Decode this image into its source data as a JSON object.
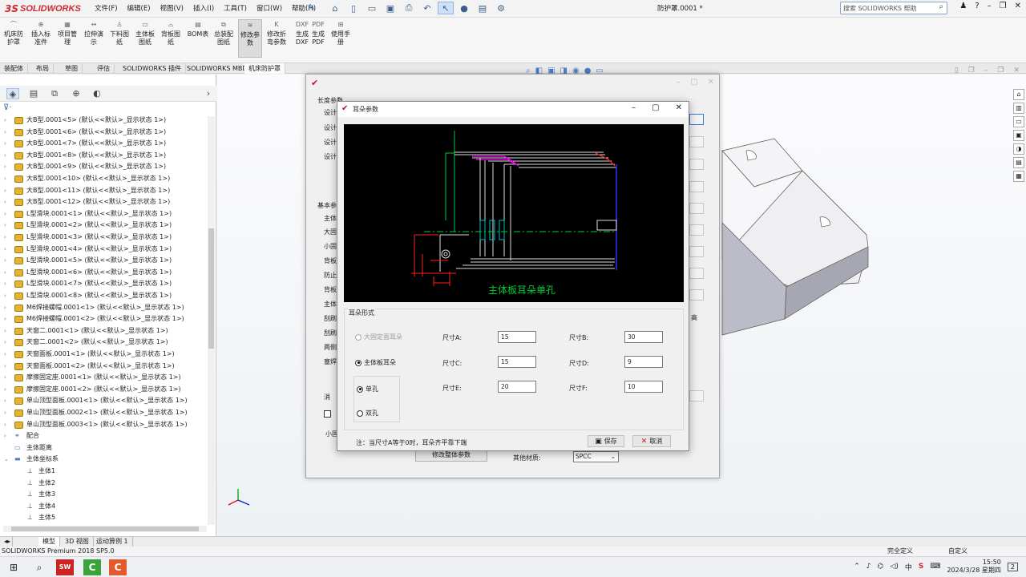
{
  "app": {
    "logo_ds": "3S",
    "logo_text": "SOLIDWORKS",
    "doc_title": "防护罩.0001 *",
    "search_placeholder": "搜索 SOLIDWORKS 帮助",
    "menus": [
      "文件(F)",
      "编辑(E)",
      "视图(V)",
      "插入(I)",
      "工具(T)",
      "窗口(W)",
      "帮助(H)"
    ]
  },
  "ribbon": {
    "buttons": [
      "机床防护罩",
      "插入标准件",
      "项目管理",
      "拉伸演示",
      "下料图纸",
      "主体板图纸",
      "背板图纸",
      "BOM表",
      "总装配图纸",
      "修改参数",
      "修改折弯参数",
      "生成DXF",
      "生成PDF",
      "使用手册"
    ]
  },
  "cmdtabs": [
    "装配体",
    "布局",
    "草图",
    "评估",
    "SOLIDWORKS 插件",
    "SOLIDWORKS MBD",
    "机床防护罩"
  ],
  "tree": {
    "items": [
      "大B型.0001<5> (默认<<默认>_显示状态 1>)",
      "大B型.0001<6> (默认<<默认>_显示状态 1>)",
      "大B型.0001<7> (默认<<默认>_显示状态 1>)",
      "大B型.0001<8> (默认<<默认>_显示状态 1>)",
      "大B型.0001<9> (默认<<默认>_显示状态 1>)",
      "大B型.0001<10> (默认<<默认>_显示状态 1>)",
      "大B型.0001<11> (默认<<默认>_显示状态 1>)",
      "大B型.0001<12> (默认<<默认>_显示状态 1>)",
      "L型滑块.0001<1> (默认<<默认>_显示状态 1>)",
      "L型滑块.0001<2> (默认<<默认>_显示状态 1>)",
      "L型滑块.0001<3> (默认<<默认>_显示状态 1>)",
      "L型滑块.0001<4> (默认<<默认>_显示状态 1>)",
      "L型滑块.0001<5> (默认<<默认>_显示状态 1>)",
      "L型滑块.0001<6> (默认<<默认>_显示状态 1>)",
      "L型滑块.0001<7> (默认<<默认>_显示状态 1>)",
      "L型滑块.0001<8> (默认<<默认>_显示状态 1>)",
      "M6焊接螺帽.0001<1> (默认<<默认>_显示状态 1>)",
      "M6焊接螺帽.0001<2> (默认<<默认>_显示状态 1>)",
      "天窗二.0001<1> (默认<<默认>_显示状态 1>)",
      "天窗二.0001<2> (默认<<默认>_显示状态 1>)",
      "天窗面板.0001<1> (默认<<默认>_显示状态 1>)",
      "天窗面板.0001<2> (默认<<默认>_显示状态 1>)",
      "摩擦固定座.0001<1> (默认<<默认>_显示状态 1>)",
      "摩擦固定座.0001<2> (默认<<默认>_显示状态 1>)",
      "单山顶型面板.0001<1> (默认<<默认>_显示状态 1>)",
      "单山顶型面板.0002<1> (默认<<默认>_显示状态 1>)",
      "单山顶型面板.0003<1> (默认<<默认>_显示状态 1>)"
    ],
    "mates": "配合",
    "origin_dist": "主体距离",
    "coord_folder": "主体坐标系",
    "coords": [
      "主体1",
      "主体2",
      "主体3",
      "主体4",
      "主体5"
    ]
  },
  "bottom_tabs": [
    "模型",
    "3D 视图",
    "运动算例 1"
  ],
  "status": {
    "version": "SOLIDWORKS Premium 2018 SP5.0",
    "defined": "完全定义",
    "custom": "自定义"
  },
  "dlg1": {
    "section_length": "长度参数",
    "design": "设计",
    "section_basic": "基本参",
    "labels": [
      "主体",
      "大固",
      "小固",
      "背板",
      "防止",
      "背板",
      "主体",
      "刮刷",
      "刮刷",
      "两侧",
      "塞焊"
    ],
    "right_label": "高",
    "bottom_btn": "修改整体参数",
    "material_label": "其他材质:",
    "material_value": "SPCC",
    "left_label1": "消",
    "left_label2": "小固"
  },
  "dlg2": {
    "title": "耳朵参数",
    "drawing_caption": "主体板耳朵单孔",
    "group_label": "耳朵形式",
    "radio_big": "大固定面耳朵",
    "radio_main": "主体板耳朵",
    "radio_single": "单孔",
    "radio_double": "双孔",
    "fields": [
      {
        "label": "尺寸A:",
        "value": "15"
      },
      {
        "label": "尺寸B:",
        "value": "30"
      },
      {
        "label": "尺寸C:",
        "value": "15"
      },
      {
        "label": "尺寸D:",
        "value": "9"
      },
      {
        "label": "尺寸E:",
        "value": "20"
      },
      {
        "label": "尺寸F:",
        "value": "10"
      }
    ],
    "note": "注：当尺寸A等于0时，耳朵齐平靠下端",
    "save": "保存",
    "cancel": "取消"
  },
  "taskbar": {
    "ime": "中",
    "time": "15:50",
    "date": "2024/3/28 星期四",
    "notif": "2"
  },
  "colors": {
    "brand": "#d22630",
    "cad_bg": "#000000",
    "cad_green": "#00cc33",
    "cad_magenta": "#ff00ff",
    "cad_red": "#ff2020",
    "cad_cyan": "#00c0c0"
  }
}
